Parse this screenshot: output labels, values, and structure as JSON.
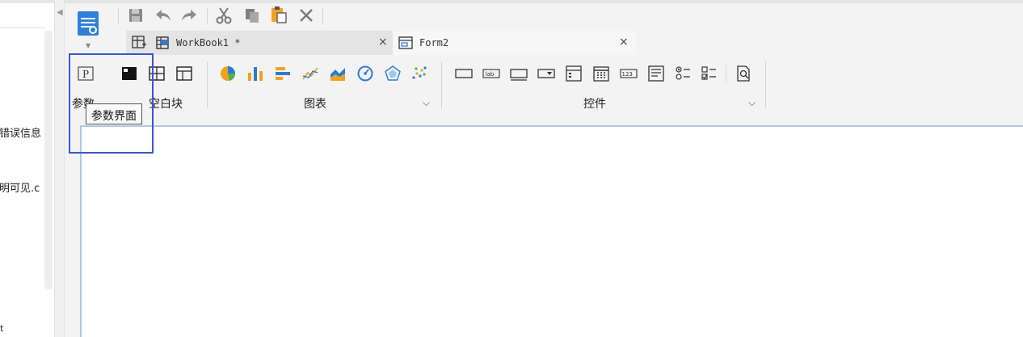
{
  "left_pane": {
    "line1": "错误信息",
    "line2": "明可见.c",
    "line3": "t"
  },
  "title_bar": {
    "app_icon": "report-designer-icon",
    "toolbar": [
      {
        "name": "save-icon"
      },
      {
        "name": "undo-icon"
      },
      {
        "name": "redo-icon"
      },
      {
        "name": "cut-icon"
      },
      {
        "name": "copy-icon"
      },
      {
        "name": "paste-icon"
      },
      {
        "name": "delete-icon"
      }
    ]
  },
  "tabs": [
    {
      "label": "WorkBook1 *",
      "close": "×",
      "active": false
    },
    {
      "label": "Form2",
      "close": "×",
      "active": true
    }
  ],
  "ribbon": {
    "groups": [
      {
        "label": "参数"
      },
      {
        "label": "空白块"
      },
      {
        "label": "图表",
        "caret": "⌵"
      },
      {
        "label": "控件",
        "caret": "⌵"
      }
    ]
  },
  "tooltip": "参数界面",
  "colors": {
    "highlight": "#3758c8",
    "chart_orange": "#f0a21f",
    "chart_blue": "#2b7bd6",
    "chart_green": "#4db34d",
    "canvas_border": "#b4c8de"
  }
}
